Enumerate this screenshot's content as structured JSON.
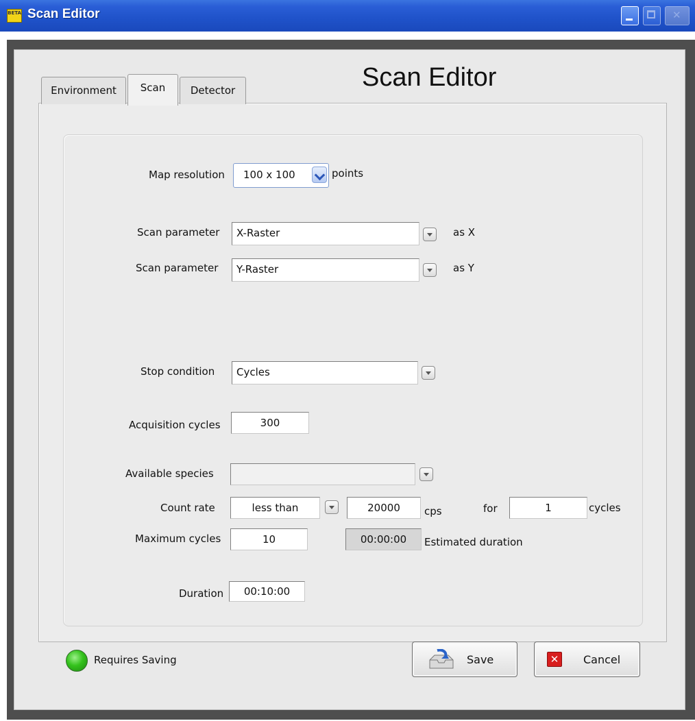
{
  "window": {
    "title": "Scan Editor",
    "app_icon_text": "BETA"
  },
  "heading": "Scan Editor",
  "tabs": [
    {
      "label": "Environment",
      "selected": false
    },
    {
      "label": "Scan",
      "selected": true
    },
    {
      "label": "Detector",
      "selected": false
    }
  ],
  "form": {
    "map_resolution": {
      "label": "Map resolution",
      "value": "100 x 100",
      "unit": "points"
    },
    "scan_x": {
      "label": "Scan parameter",
      "value": "X-Raster",
      "suffix": "as X"
    },
    "scan_y": {
      "label": "Scan parameter",
      "value": "Y-Raster",
      "suffix": "as Y"
    },
    "stop_condition": {
      "label": "Stop condition",
      "value": "Cycles"
    },
    "acquisition_cycles": {
      "label": "Acquisition cycles",
      "value": "300"
    },
    "available_species": {
      "label": "Available species",
      "value": ""
    },
    "count_rate": {
      "label": "Count rate",
      "comparator": "less than",
      "value": "20000",
      "unit": "cps",
      "for_label": "for",
      "cycles_value": "1",
      "cycles_unit": "cycles"
    },
    "maximum_cycles": {
      "label": "Maximum cycles",
      "value": "10"
    },
    "estimated_duration": {
      "value": "00:00:00",
      "label": "Estimated duration"
    },
    "duration": {
      "label": "Duration",
      "value": "00:10:00"
    }
  },
  "status": {
    "label": "Requires Saving",
    "led_color": "#34c21c"
  },
  "buttons": {
    "save": "Save",
    "cancel": "Cancel"
  }
}
